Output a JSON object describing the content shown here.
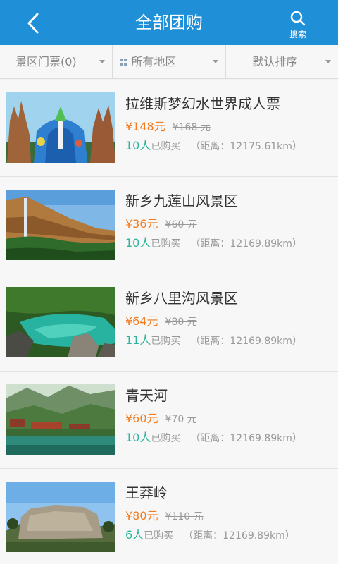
{
  "header": {
    "title": "全部团购",
    "search_label": "搜索"
  },
  "filters": {
    "category": "景区门票(0)",
    "region": "所有地区",
    "sort": "默认排序"
  },
  "items": [
    {
      "name": "拉维斯梦幻水世界成人票",
      "price": "¥148元",
      "original_price": "¥168 元",
      "count": "10人",
      "bought_label": "已购买",
      "distance": "（距离：12175.61km）"
    },
    {
      "name": "新乡九莲山风景区",
      "price": "¥36元",
      "original_price": "¥60 元",
      "count": "10人",
      "bought_label": "已购买",
      "distance": "（距离：12169.89km）"
    },
    {
      "name": "新乡八里沟风景区",
      "price": "¥64元",
      "original_price": "¥80 元",
      "count": "11人",
      "bought_label": "已购买",
      "distance": "（距离：12169.89km）"
    },
    {
      "name": "青天河",
      "price": "¥60元",
      "original_price": "¥70 元",
      "count": "10人",
      "bought_label": "已购买",
      "distance": "（距离：12169.89km）"
    },
    {
      "name": "王莽岭",
      "price": "¥80元",
      "original_price": "¥110 元",
      "count": "6人",
      "bought_label": "已购买",
      "distance": "（距离：12169.89km）"
    }
  ]
}
